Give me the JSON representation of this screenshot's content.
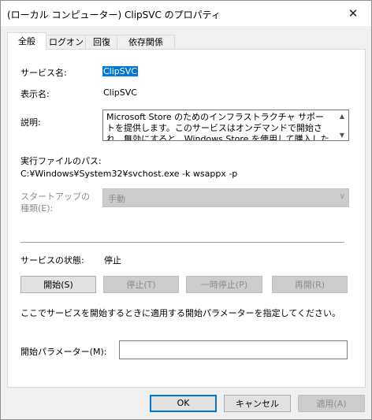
{
  "window": {
    "title": "(ローカル コンピューター) ClipSVC のプロパティ",
    "close_glyph": "✕"
  },
  "tabs": [
    {
      "label": "全般",
      "active": true
    },
    {
      "label": "ログオン",
      "active": false
    },
    {
      "label": "回復",
      "active": false
    },
    {
      "label": "依存関係",
      "active": false
    }
  ],
  "general": {
    "service_name_label": "サービス名:",
    "service_name_value": "ClipSVC",
    "display_name_label": "表示名:",
    "display_name_value": "ClipSVC",
    "description_label": "説明:",
    "description_value": "Microsoft Store のためのインフラストラクチャ サポートを提供します。このサービスはオンデマンドで開始され、無効にすると、Windows Store を使用して購入したアプリケーションが正しく",
    "path_label": "実行ファイルのパス:",
    "path_value": "C:¥Windows¥System32¥svchost.exe -k wsappx -p",
    "startup_label_line1": "スタートアップの",
    "startup_label_line2": "種類(E):",
    "startup_value": "手動",
    "status_label": "サービスの状態:",
    "status_value": "停止",
    "hint_text": "ここでサービスを開始するときに適用する開始パラメーターを指定してください。",
    "param_label": "開始パラメーター(M):",
    "param_value": ""
  },
  "service_buttons": {
    "start": "開始(S)",
    "stop": "停止(T)",
    "pause": "一時停止(P)",
    "resume": "再開(R)"
  },
  "dialog_buttons": {
    "ok": "OK",
    "cancel": "キャンセル",
    "apply": "適用(A)"
  },
  "icons": {
    "close": "close-icon",
    "scroll_up": "scroll-up-icon",
    "scroll_down": "scroll-down-icon",
    "dropdown": "chevron-down-icon"
  },
  "colors": {
    "selection": "#0078d7",
    "default_button_border": "#0078d7",
    "disabled_text": "#8d8d8d"
  }
}
